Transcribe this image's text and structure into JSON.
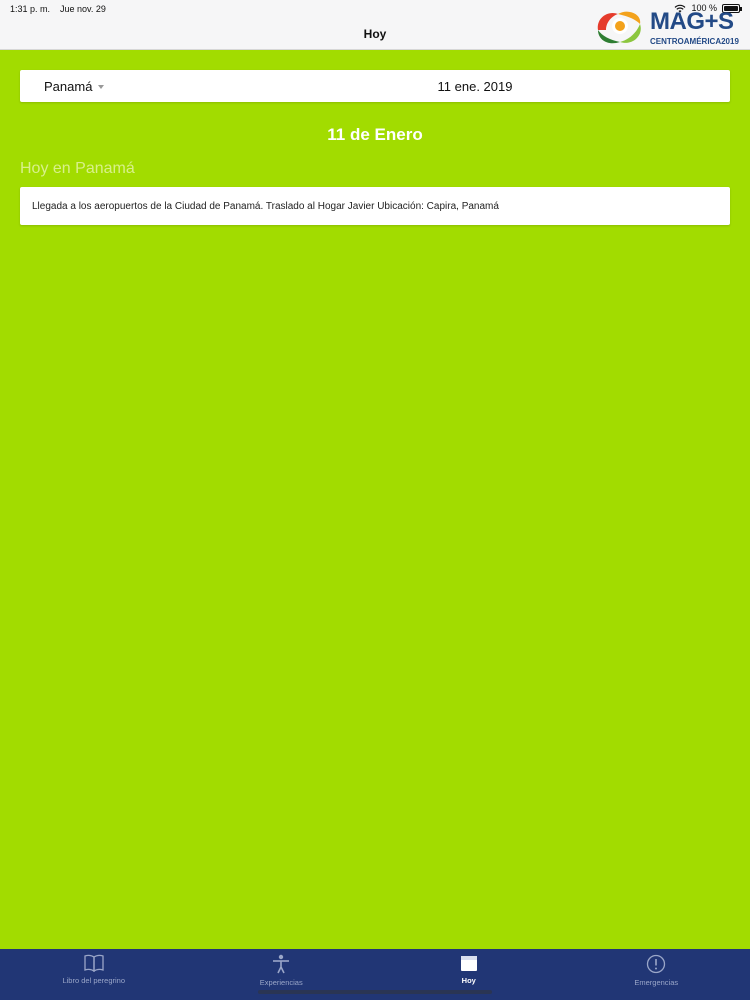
{
  "status": {
    "time": "1:31 p. m.",
    "date": "Jue nov. 29",
    "battery": "100 %"
  },
  "nav": {
    "title": "Hoy"
  },
  "logo": {
    "brand": "MAG+S",
    "sub": "CENTROAMÉRICA2019"
  },
  "filter": {
    "country": "Panamá",
    "date": "11 ene. 2019"
  },
  "day": {
    "heading": "11 de Enero"
  },
  "section": {
    "title": "Hoy en Panamá",
    "events": [
      {
        "text": "Llegada a los aeropuertos de la Ciudad de Panamá. Traslado al Hogar Javier Ubicación: Capira, Panamá"
      }
    ]
  },
  "tabs": [
    {
      "label": "Libro del peregrino",
      "icon": "book-icon",
      "active": false
    },
    {
      "label": "Experiencias",
      "icon": "person-icon",
      "active": false
    },
    {
      "label": "Hoy",
      "icon": "calendar-icon",
      "active": true
    },
    {
      "label": "Emergencias",
      "icon": "alert-icon",
      "active": false
    }
  ],
  "colors": {
    "background": "#a2dc00",
    "tabbar": "#213675",
    "brand": "#234a86"
  }
}
